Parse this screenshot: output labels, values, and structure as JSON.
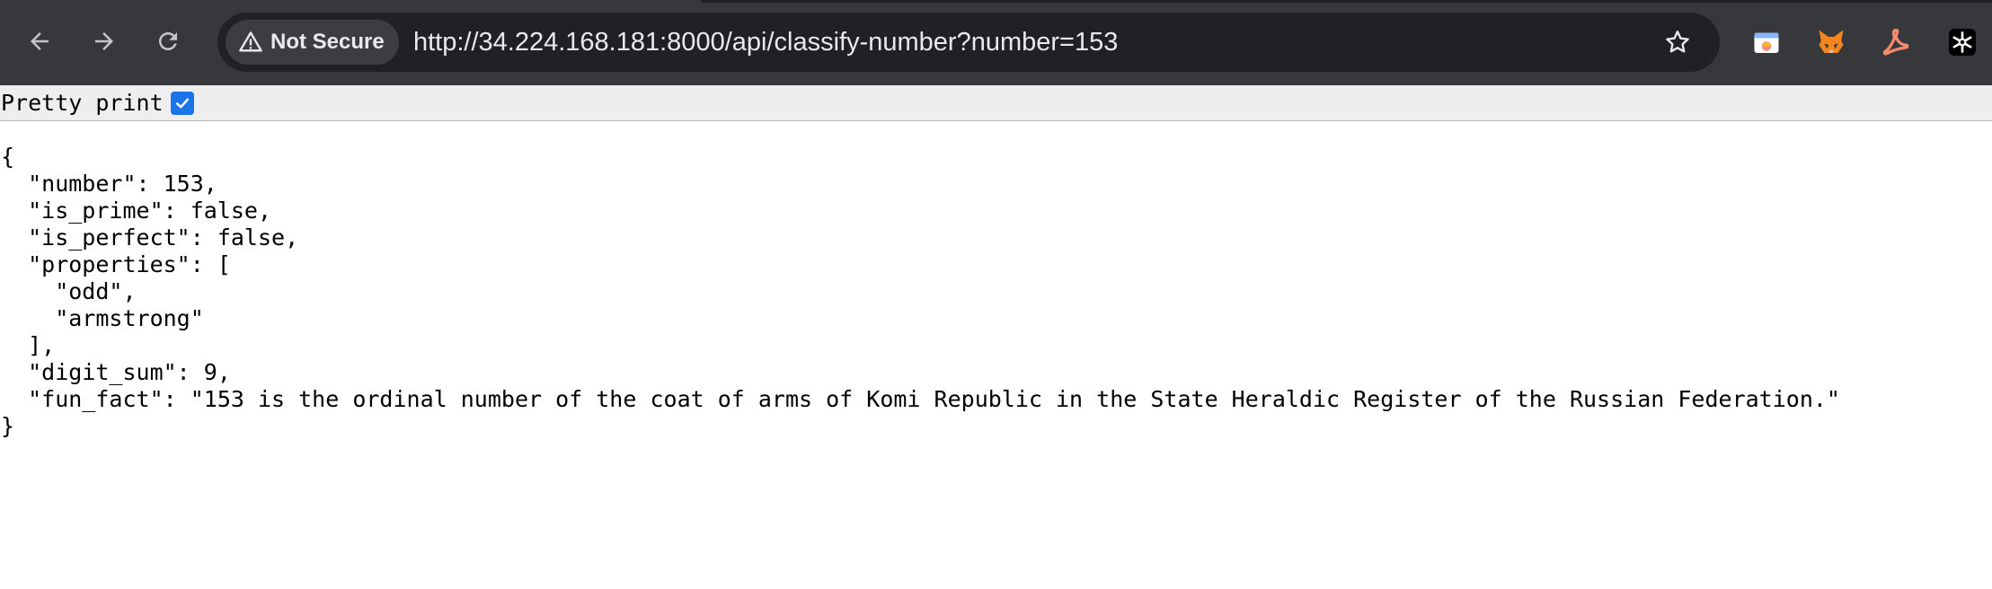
{
  "browser": {
    "security_label": "Not Secure",
    "url": "http://34.224.168.181:8000/api/classify-number?number=153",
    "icons": {
      "back": "back-arrow-icon",
      "forward": "forward-arrow-icon",
      "reload": "reload-icon",
      "security": "warning-triangle-icon",
      "bookmark": "star-icon",
      "extensions": [
        "window-extension-icon",
        "fox-extension-icon",
        "acrobat-extension-icon",
        "snowflake-extension-icon"
      ]
    },
    "colors": {
      "toolbar": "#37383b",
      "omnibox": "#202124",
      "text": "#e8eaed",
      "checkbox": "#1a73e8"
    }
  },
  "pretty_print": {
    "label": "Pretty print",
    "checked": true
  },
  "json_lines": [
    "{",
    "  \"number\": 153,",
    "  \"is_prime\": false,",
    "  \"is_perfect\": false,",
    "  \"properties\": [",
    "    \"odd\",",
    "    \"armstrong\"",
    "  ],",
    "  \"digit_sum\": 9,",
    "  \"fun_fact\": \"153 is the ordinal number of the coat of arms of Komi Republic in the State Heraldic Register of the Russian Federation.\"",
    "}"
  ]
}
